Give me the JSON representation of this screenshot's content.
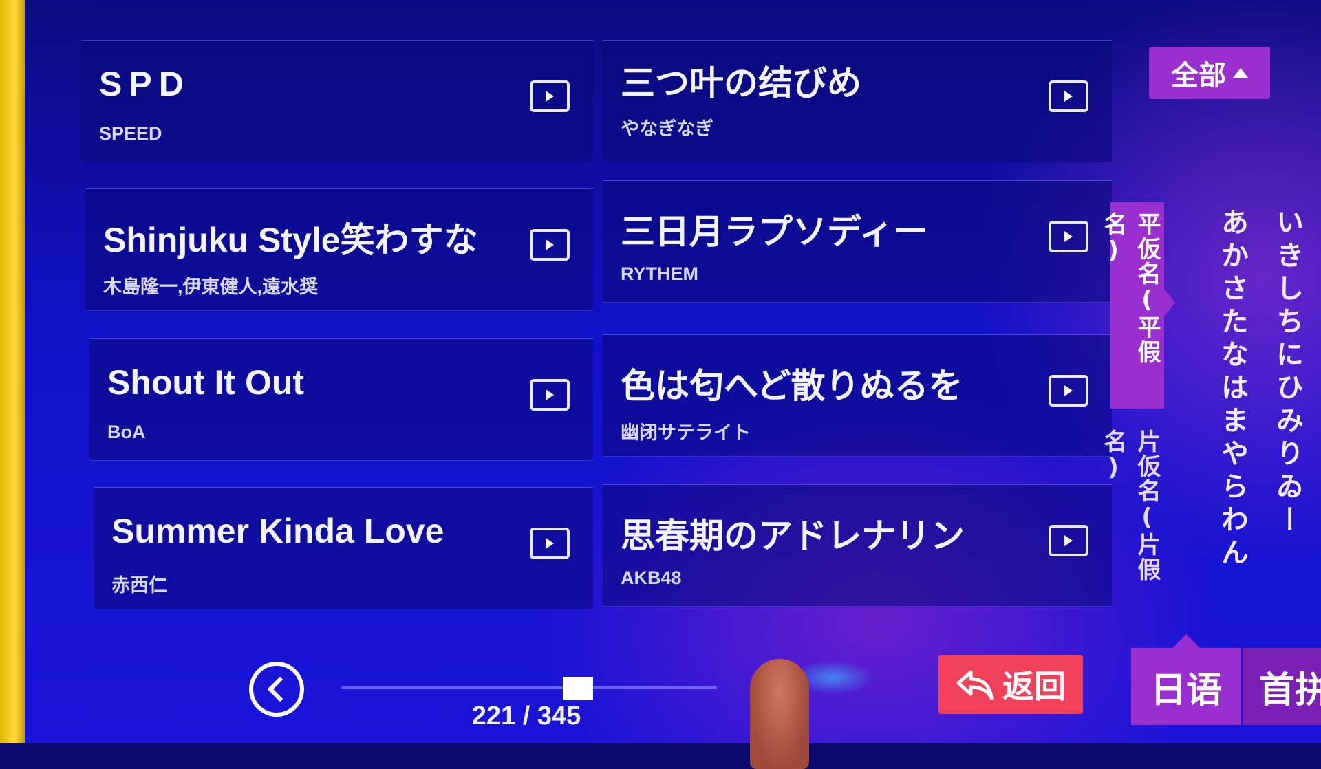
{
  "songs": [
    {
      "title": "SPD",
      "artist": "SPEED"
    },
    {
      "title": "三つ叶の结びめ",
      "artist": "やなぎなぎ"
    },
    {
      "title": "Shinjuku Style笑わすな",
      "artist": "木島隆一,伊東健人,遠水奨"
    },
    {
      "title": "三日月ラプソディー",
      "artist": "RYTHEM"
    },
    {
      "title": "Shout It Out",
      "artist": "BoA"
    },
    {
      "title": "色は匂へど散りぬるを",
      "artist": "幽闭サテライト"
    },
    {
      "title": "Summer Kinda Love",
      "artist": "赤西仁"
    },
    {
      "title": "思春期のアドレナリン",
      "artist": "AKB48"
    }
  ],
  "filter": {
    "all_label": "全部"
  },
  "kana": {
    "hiragana_tab": "平仮名(平假名)",
    "katakana_tab": "片仮名(片假名)",
    "column1": "あかさたなはまやらわん",
    "column2": "いきしちにひみりゐー"
  },
  "pager": {
    "counter": "221 / 345",
    "current": 221,
    "total": 345
  },
  "return_label": "返回",
  "language_tabs": {
    "active": "日语",
    "next": "首拼"
  },
  "icons": {
    "play": "play-video-icon",
    "back": "chevron-left-icon",
    "return": "return-arrow-icon",
    "caret": "caret-up-icon"
  },
  "colors": {
    "accent_purple": "#9a2fd0",
    "return_red": "#f0405a",
    "background_blue": "#1111c8"
  }
}
